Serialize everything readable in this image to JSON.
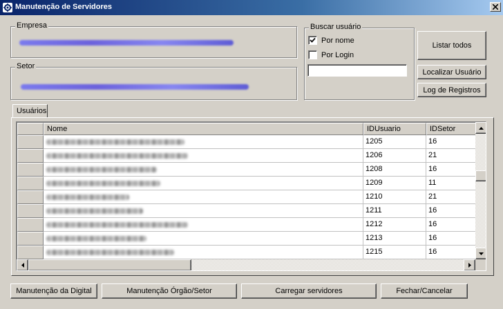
{
  "window": {
    "title": "Manutenção de Servidores"
  },
  "empresa": {
    "label": "Empresa"
  },
  "setor": {
    "label": "Setor"
  },
  "buscar": {
    "label": "Buscar usuário",
    "por_nome_label": "Por nome",
    "por_nome_checked": true,
    "por_login_label": "Por Login",
    "por_login_checked": false,
    "search_value": ""
  },
  "actions": {
    "listar_todos": "Listar todos",
    "localizar_usuario": "Localizar Usuário",
    "log_registros": "Log de Registros"
  },
  "tabs": [
    {
      "label": "Usuários",
      "active": true
    }
  ],
  "grid": {
    "columns": [
      "Nome",
      "IDUsuario",
      "IDSetor"
    ],
    "rows": [
      {
        "idusuario": "1205",
        "idsetor": "16"
      },
      {
        "idusuario": "1206",
        "idsetor": "21"
      },
      {
        "idusuario": "1208",
        "idsetor": "16"
      },
      {
        "idusuario": "1209",
        "idsetor": "11"
      },
      {
        "idusuario": "1210",
        "idsetor": "21"
      },
      {
        "idusuario": "1211",
        "idsetor": "16"
      },
      {
        "idusuario": "1212",
        "idsetor": "16"
      },
      {
        "idusuario": "1213",
        "idsetor": "16"
      },
      {
        "idusuario": "1215",
        "idsetor": "16"
      }
    ]
  },
  "footer": {
    "manutencao_digital": "Manutenção da Digital",
    "manutencao_orgao": "Manutenção Órgão/Setor",
    "carregar_servidores": "Carregar servidores",
    "fechar_cancelar": "Fechar/Cancelar"
  },
  "icons": {
    "app": "app-gear-icon",
    "close": "close-icon",
    "check": "checkmark-icon",
    "scroll_up": "arrow-up-icon",
    "scroll_down": "arrow-down-icon",
    "scroll_left": "arrow-left-icon",
    "scroll_right": "arrow-right-icon"
  },
  "colors": {
    "title_start": "#0a246a",
    "title_end": "#a6caf0",
    "face": "#d4d0c8"
  }
}
